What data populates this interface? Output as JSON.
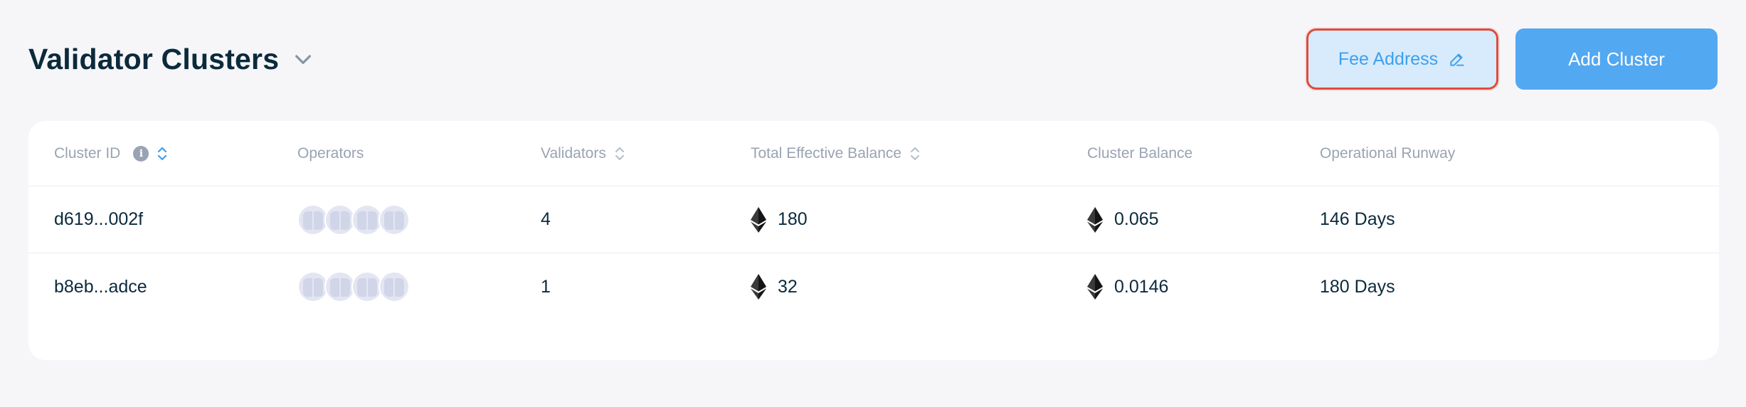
{
  "header": {
    "title": "Validator Clusters",
    "fee_address_label": "Fee Address",
    "add_cluster_label": "Add Cluster"
  },
  "table": {
    "columns": {
      "cluster_id": "Cluster ID",
      "operators": "Operators",
      "validators": "Validators",
      "total_effective_balance": "Total Effective Balance",
      "cluster_balance": "Cluster Balance",
      "operational_runway": "Operational Runway"
    },
    "rows": [
      {
        "cluster_id": "d619...002f",
        "validators": "4",
        "total_effective_balance": "180",
        "cluster_balance": "0.065",
        "operational_runway": "146 Days"
      },
      {
        "cluster_id": "b8eb...adce",
        "validators": "1",
        "total_effective_balance": "32",
        "cluster_balance": "0.0146",
        "operational_runway": "180 Days"
      }
    ]
  },
  "colors": {
    "title": "#0b2a3c",
    "accent": "#52a8f1",
    "fee_button_bg": "#d7ebfc",
    "highlight_border": "#e14b3a",
    "muted": "#9aa3b3"
  },
  "icons": {
    "title_dropdown": "chevron-down-icon",
    "fee_edit": "pencil-icon",
    "info": "info-icon",
    "sort": "sort-icon",
    "currency": "ethereum-icon",
    "operator": "operator-avatar-icon"
  }
}
